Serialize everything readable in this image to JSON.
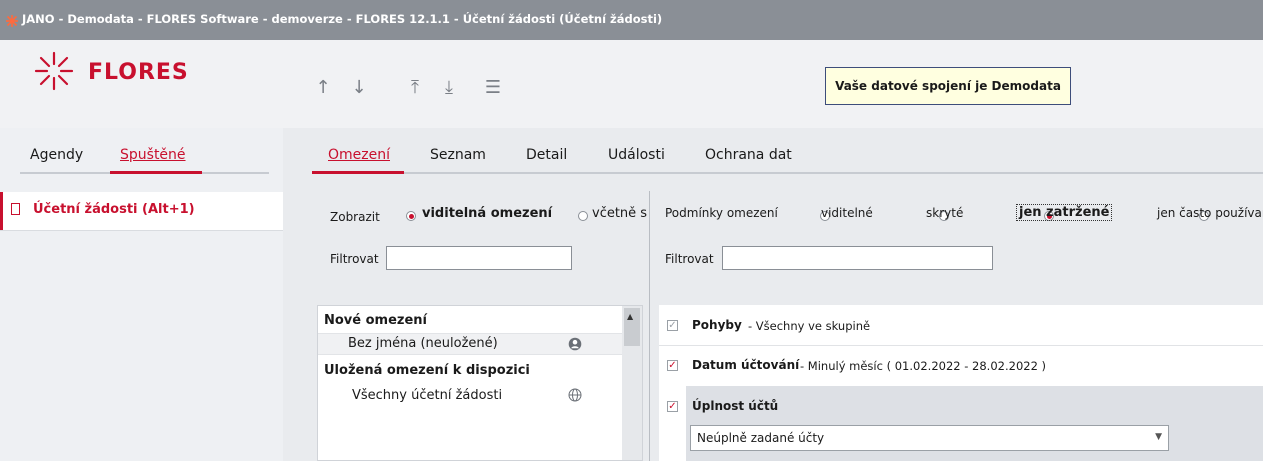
{
  "window": {
    "title": "JANO - Demodata - FLORES Software - demoverze - FLORES 12.1.1 - Účetní žádosti  (Účetní žádosti)"
  },
  "brand": {
    "name": "FLORES"
  },
  "toolbar": {
    "up": "↑",
    "down": "↓",
    "top": "⤒",
    "bottom": "⤓",
    "menu": "☰"
  },
  "connection": {
    "text": "Vaše datové spojení je Demodata"
  },
  "left_tabs": [
    {
      "label": "Agendy"
    },
    {
      "label": "Spuštěné"
    }
  ],
  "running": [
    {
      "label": "Účetní žádosti (Alt+1)"
    }
  ],
  "main_tabs": [
    {
      "label": "Omezení"
    },
    {
      "label": "Seznam"
    },
    {
      "label": "Detail"
    },
    {
      "label": "Události"
    },
    {
      "label": "Ochrana dat"
    }
  ],
  "left_filter": {
    "show_label": "Zobrazit",
    "options": [
      {
        "label": "viditelná omezení",
        "selected": true
      },
      {
        "label": "včetně s",
        "selected": false
      }
    ],
    "filter_label": "Filtrovat",
    "filter_value": ""
  },
  "right_filter": {
    "conditions_label": "Podmínky omezení",
    "options": [
      {
        "label": "viditelné",
        "selected": false
      },
      {
        "label": "skryté",
        "selected": false
      },
      {
        "label": "jen zatržené",
        "selected": true
      },
      {
        "label": "jen často používan",
        "selected": false
      }
    ],
    "filter_label": "Filtrovat",
    "filter_value": ""
  },
  "restrictions": {
    "new_group": "Nové omezení",
    "new_item": "Bez jména (neuložené)",
    "saved_group": "Uložená omezení k dispozici",
    "saved_item": "Všechny účetní žádosti"
  },
  "conditions": [
    {
      "name": "Pohyby",
      "desc": "- Všechny ve skupině",
      "checked": true,
      "disabled": true
    },
    {
      "name": "Datum účtování",
      "desc": "- Minulý měsíc ( 01.02.2022 - 28.02.2022 )",
      "checked": true,
      "disabled": false
    },
    {
      "name": "Úplnost účtů",
      "desc": "",
      "checked": true,
      "disabled": false,
      "select_value": "Neúplně zadané účty"
    }
  ],
  "colors": {
    "accent": "#c8102e",
    "titlebar": "#8a8f96",
    "conn_bg": "#ffffe0"
  }
}
